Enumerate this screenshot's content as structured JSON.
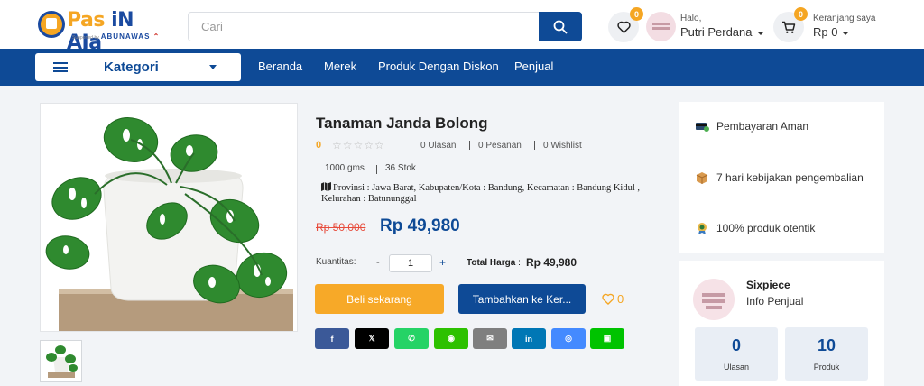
{
  "header": {
    "logo": {
      "brand_a": "Pas ",
      "brand_b": "iN AJa",
      "sub_small": "Supported by",
      "sub": "ABUNAWAS"
    },
    "search": {
      "placeholder": "Cari"
    },
    "wishlist_count": "0",
    "user": {
      "greeting": "Halo,",
      "name": "Putri Perdana"
    },
    "cart": {
      "count": "0",
      "label": "Keranjang saya",
      "total": "Rp 0"
    }
  },
  "nav": {
    "kategori": "Kategori",
    "links": [
      "Beranda",
      "Merek",
      "Produk Dengan Diskon",
      "Penjual"
    ]
  },
  "product": {
    "title": "Tanaman Janda Bolong",
    "rating": "0",
    "stars": "☆☆☆☆☆",
    "reviews": "0 Ulasan",
    "orders": "0 Pesanan",
    "wishlist": "0 Wishlist",
    "weight": "1000 gms",
    "stock": "36 Stok",
    "location": "Provinsi : Jawa Barat, Kabupaten/Kota : Bandung, Kecamatan : Bandung Kidul , Kelurahan : Batununggal",
    "price_old": "Rp 50,000",
    "price_new": "Rp 49,980",
    "qty_label": "Kuantitas:",
    "qty_minus": "-",
    "qty_value": "1",
    "qty_plus": "+",
    "total_label": "Total Harga",
    "total_sep": ":",
    "total_value": "Rp 49,980",
    "buy_now": "Beli sekarang",
    "add_to_cart": "Tambahkan ke Ker...",
    "fav_count": "0"
  },
  "share": [
    {
      "name": "facebook",
      "glyph": "f",
      "color": "#3b5998"
    },
    {
      "name": "x",
      "glyph": "𝕏",
      "color": "#000000"
    },
    {
      "name": "whatsapp",
      "glyph": "✆",
      "color": "#25d366"
    },
    {
      "name": "wechat",
      "glyph": "◉",
      "color": "#2dc100"
    },
    {
      "name": "email",
      "glyph": "✉",
      "color": "#7f7f7f"
    },
    {
      "name": "linkedin",
      "glyph": "in",
      "color": "#0077b5"
    },
    {
      "name": "messenger",
      "glyph": "◎",
      "color": "#448aff"
    },
    {
      "name": "line",
      "glyph": "▣",
      "color": "#00c300"
    }
  ],
  "features": [
    {
      "label": "Pembayaran Aman",
      "icon": "secure-payment-icon"
    },
    {
      "label": "7 hari kebijakan pengembalian",
      "icon": "return-box-icon"
    },
    {
      "label": "100% produk otentik",
      "icon": "authentic-badge-icon"
    }
  ],
  "seller": {
    "name": "Sixpiece",
    "info": "Info Penjual",
    "reviews_value": "0",
    "reviews_label": "Ulasan",
    "products_value": "10",
    "products_label": "Produk"
  },
  "colors": {
    "primary": "#0e4a96",
    "accent": "#f5a623",
    "danger": "#e74c3c"
  }
}
